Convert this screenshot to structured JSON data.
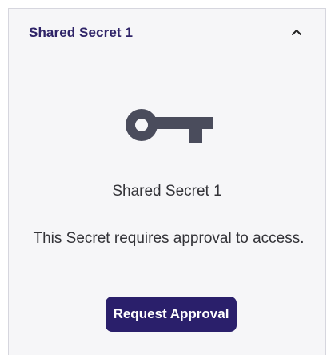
{
  "panel": {
    "title": "Shared Secret 1",
    "collapse_icon": "chevron-up-icon"
  },
  "content": {
    "icon": "key-icon",
    "icon_color": "#4a4c5c",
    "secret_name": "Shared Secret 1",
    "message": "This Secret requires approval to access.",
    "button_label": "Request Approval",
    "button_color": "#2a1f6b"
  }
}
